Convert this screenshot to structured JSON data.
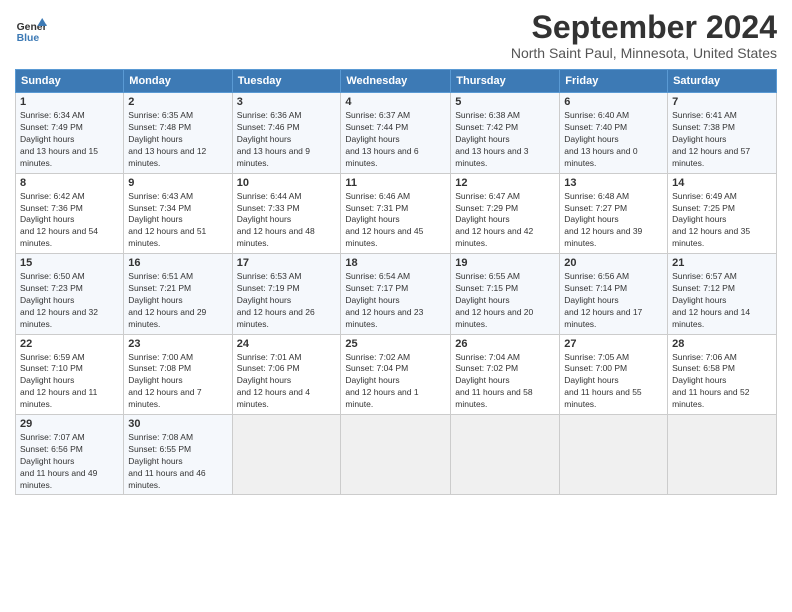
{
  "header": {
    "logo_line1": "General",
    "logo_line2": "Blue",
    "month": "September 2024",
    "location": "North Saint Paul, Minnesota, United States"
  },
  "weekdays": [
    "Sunday",
    "Monday",
    "Tuesday",
    "Wednesday",
    "Thursday",
    "Friday",
    "Saturday"
  ],
  "weeks": [
    [
      {
        "day": "1",
        "sunrise": "6:34 AM",
        "sunset": "7:49 PM",
        "daylight": "13 hours and 15 minutes."
      },
      {
        "day": "2",
        "sunrise": "6:35 AM",
        "sunset": "7:48 PM",
        "daylight": "13 hours and 12 minutes."
      },
      {
        "day": "3",
        "sunrise": "6:36 AM",
        "sunset": "7:46 PM",
        "daylight": "13 hours and 9 minutes."
      },
      {
        "day": "4",
        "sunrise": "6:37 AM",
        "sunset": "7:44 PM",
        "daylight": "13 hours and 6 minutes."
      },
      {
        "day": "5",
        "sunrise": "6:38 AM",
        "sunset": "7:42 PM",
        "daylight": "13 hours and 3 minutes."
      },
      {
        "day": "6",
        "sunrise": "6:40 AM",
        "sunset": "7:40 PM",
        "daylight": "13 hours and 0 minutes."
      },
      {
        "day": "7",
        "sunrise": "6:41 AM",
        "sunset": "7:38 PM",
        "daylight": "12 hours and 57 minutes."
      }
    ],
    [
      {
        "day": "8",
        "sunrise": "6:42 AM",
        "sunset": "7:36 PM",
        "daylight": "12 hours and 54 minutes."
      },
      {
        "day": "9",
        "sunrise": "6:43 AM",
        "sunset": "7:34 PM",
        "daylight": "12 hours and 51 minutes."
      },
      {
        "day": "10",
        "sunrise": "6:44 AM",
        "sunset": "7:33 PM",
        "daylight": "12 hours and 48 minutes."
      },
      {
        "day": "11",
        "sunrise": "6:46 AM",
        "sunset": "7:31 PM",
        "daylight": "12 hours and 45 minutes."
      },
      {
        "day": "12",
        "sunrise": "6:47 AM",
        "sunset": "7:29 PM",
        "daylight": "12 hours and 42 minutes."
      },
      {
        "day": "13",
        "sunrise": "6:48 AM",
        "sunset": "7:27 PM",
        "daylight": "12 hours and 39 minutes."
      },
      {
        "day": "14",
        "sunrise": "6:49 AM",
        "sunset": "7:25 PM",
        "daylight": "12 hours and 35 minutes."
      }
    ],
    [
      {
        "day": "15",
        "sunrise": "6:50 AM",
        "sunset": "7:23 PM",
        "daylight": "12 hours and 32 minutes."
      },
      {
        "day": "16",
        "sunrise": "6:51 AM",
        "sunset": "7:21 PM",
        "daylight": "12 hours and 29 minutes."
      },
      {
        "day": "17",
        "sunrise": "6:53 AM",
        "sunset": "7:19 PM",
        "daylight": "12 hours and 26 minutes."
      },
      {
        "day": "18",
        "sunrise": "6:54 AM",
        "sunset": "7:17 PM",
        "daylight": "12 hours and 23 minutes."
      },
      {
        "day": "19",
        "sunrise": "6:55 AM",
        "sunset": "7:15 PM",
        "daylight": "12 hours and 20 minutes."
      },
      {
        "day": "20",
        "sunrise": "6:56 AM",
        "sunset": "7:14 PM",
        "daylight": "12 hours and 17 minutes."
      },
      {
        "day": "21",
        "sunrise": "6:57 AM",
        "sunset": "7:12 PM",
        "daylight": "12 hours and 14 minutes."
      }
    ],
    [
      {
        "day": "22",
        "sunrise": "6:59 AM",
        "sunset": "7:10 PM",
        "daylight": "12 hours and 11 minutes."
      },
      {
        "day": "23",
        "sunrise": "7:00 AM",
        "sunset": "7:08 PM",
        "daylight": "12 hours and 7 minutes."
      },
      {
        "day": "24",
        "sunrise": "7:01 AM",
        "sunset": "7:06 PM",
        "daylight": "12 hours and 4 minutes."
      },
      {
        "day": "25",
        "sunrise": "7:02 AM",
        "sunset": "7:04 PM",
        "daylight": "12 hours and 1 minute."
      },
      {
        "day": "26",
        "sunrise": "7:04 AM",
        "sunset": "7:02 PM",
        "daylight": "11 hours and 58 minutes."
      },
      {
        "day": "27",
        "sunrise": "7:05 AM",
        "sunset": "7:00 PM",
        "daylight": "11 hours and 55 minutes."
      },
      {
        "day": "28",
        "sunrise": "7:06 AM",
        "sunset": "6:58 PM",
        "daylight": "11 hours and 52 minutes."
      }
    ],
    [
      {
        "day": "29",
        "sunrise": "7:07 AM",
        "sunset": "6:56 PM",
        "daylight": "11 hours and 49 minutes."
      },
      {
        "day": "30",
        "sunrise": "7:08 AM",
        "sunset": "6:55 PM",
        "daylight": "11 hours and 46 minutes."
      },
      null,
      null,
      null,
      null,
      null
    ]
  ]
}
